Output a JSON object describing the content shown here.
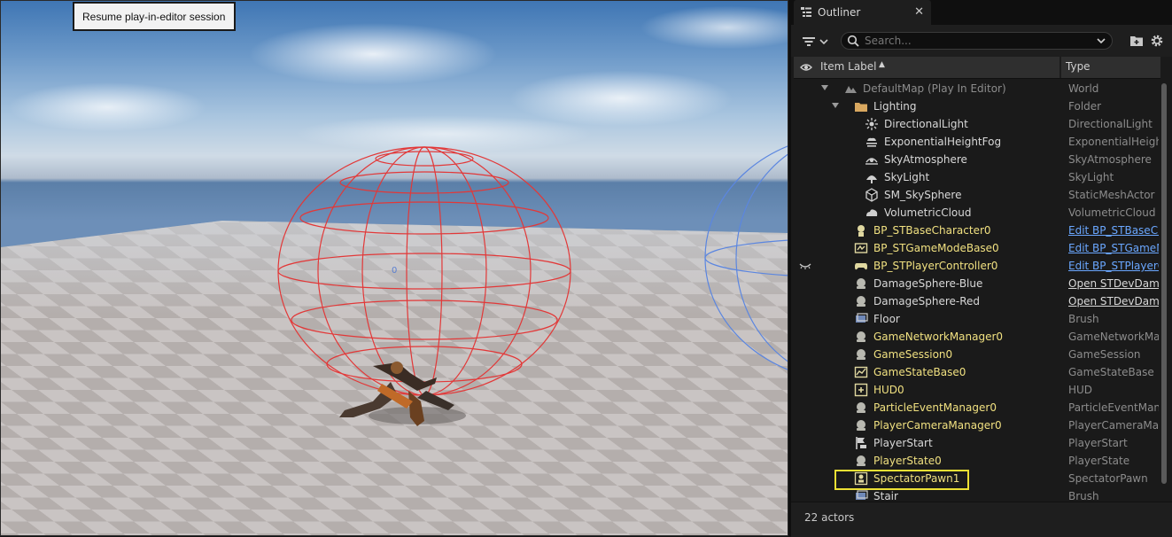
{
  "viewport": {
    "tooltip": "Resume play-in-editor session",
    "marker_text": "0"
  },
  "outliner": {
    "tab_label": "Outliner",
    "search_placeholder": "Search...",
    "column_item_label": "Item Label",
    "column_type": "Type",
    "actor_count": "22 actors",
    "rows": [
      {
        "label": "DefaultMap (Play In Editor)",
        "type": "World",
        "icon": "world-icon",
        "indent": 0,
        "arrow": true,
        "color": "#8c8c8c"
      },
      {
        "label": "Lighting",
        "type": "Folder",
        "icon": "folder-icon",
        "indent": 1,
        "arrow": true,
        "color": "#d8d8d8"
      },
      {
        "label": "DirectionalLight",
        "type": "DirectionalLight",
        "icon": "directional-light-icon",
        "indent": 2,
        "color": "#d8d8d8"
      },
      {
        "label": "ExponentialHeightFog",
        "type": "ExponentialHeight",
        "icon": "fog-icon",
        "indent": 2,
        "color": "#d8d8d8"
      },
      {
        "label": "SkyAtmosphere",
        "type": "SkyAtmosphere",
        "icon": "sky-atmosphere-icon",
        "indent": 2,
        "color": "#d8d8d8"
      },
      {
        "label": "SkyLight",
        "type": "SkyLight",
        "icon": "sky-light-icon",
        "indent": 2,
        "color": "#d8d8d8"
      },
      {
        "label": "SM_SkySphere",
        "type": "StaticMeshActor",
        "icon": "static-mesh-icon",
        "indent": 2,
        "color": "#d8d8d8"
      },
      {
        "label": "VolumetricCloud",
        "type": "VolumetricCloud",
        "icon": "cloud-icon",
        "indent": 2,
        "color": "#d8d8d8"
      },
      {
        "label": "BP_STBaseCharacter0",
        "type": "Edit BP_STBaseCh",
        "icon": "character-icon",
        "indent": 1,
        "color": "#f0e080",
        "type_style": "link"
      },
      {
        "label": "BP_STGameModeBase0",
        "type": "Edit BP_STGameM",
        "icon": "game-mode-icon",
        "indent": 1,
        "color": "#f0e080",
        "type_style": "link"
      },
      {
        "label": "BP_STPlayerController0",
        "type": "Edit BP_STPlayerC",
        "icon": "gamepad-icon",
        "indent": 1,
        "color": "#f0e080",
        "type_style": "link",
        "hidden_eye": true
      },
      {
        "label": "DamageSphere-Blue",
        "type": "Open STDevDama",
        "icon": "actor-icon",
        "indent": 1,
        "color": "#d8d8d8",
        "type_style": "open"
      },
      {
        "label": "DamageSphere-Red",
        "type": "Open STDevDama",
        "icon": "actor-icon",
        "indent": 1,
        "color": "#d8d8d8",
        "type_style": "open"
      },
      {
        "label": "Floor",
        "type": "Brush",
        "icon": "brush-icon",
        "indent": 1,
        "color": "#d8d8d8"
      },
      {
        "label": "GameNetworkManager0",
        "type": "GameNetworkMan",
        "icon": "actor-icon",
        "indent": 1,
        "color": "#f0e080"
      },
      {
        "label": "GameSession0",
        "type": "GameSession",
        "icon": "actor-icon",
        "indent": 1,
        "color": "#f0e080"
      },
      {
        "label": "GameStateBase0",
        "type": "GameStateBase",
        "icon": "game-state-icon",
        "indent": 1,
        "color": "#f0e080"
      },
      {
        "label": "HUD0",
        "type": "HUD",
        "icon": "hud-icon",
        "indent": 1,
        "color": "#f0e080"
      },
      {
        "label": "ParticleEventManager0",
        "type": "ParticleEventMana",
        "icon": "actor-icon",
        "indent": 1,
        "color": "#f0e080"
      },
      {
        "label": "PlayerCameraManager0",
        "type": "PlayerCameraMan",
        "icon": "actor-icon",
        "indent": 1,
        "color": "#f0e080"
      },
      {
        "label": "PlayerStart",
        "type": "PlayerStart",
        "icon": "player-start-icon",
        "indent": 1,
        "color": "#d8d8d8"
      },
      {
        "label": "PlayerState0",
        "type": "PlayerState",
        "icon": "actor-icon",
        "indent": 1,
        "color": "#f0e080"
      },
      {
        "label": "SpectatorPawn1",
        "type": "SpectatorPawn",
        "icon": "spectator-pawn-icon",
        "indent": 1,
        "color": "#f0e080"
      },
      {
        "label": "Stair",
        "type": "Brush",
        "icon": "brush-icon",
        "indent": 1,
        "color": "#d8d8d8"
      }
    ]
  },
  "colors": {
    "highlight": "#ece034",
    "link": "#6aa7ff",
    "runtime_actor": "#f0e080"
  }
}
